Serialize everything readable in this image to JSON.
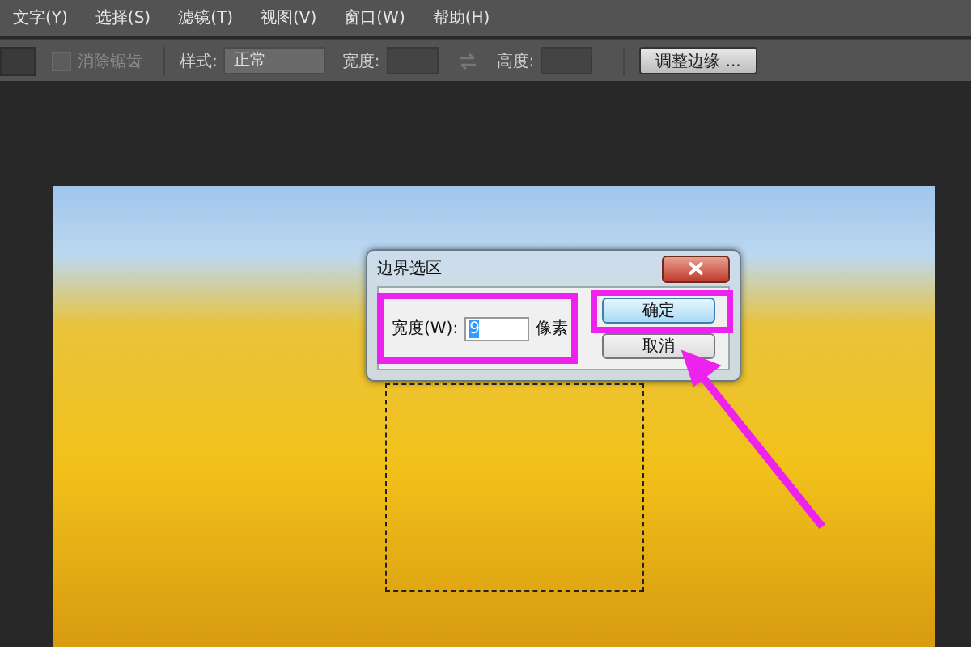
{
  "menu": [
    {
      "label": "文字(Y)"
    },
    {
      "label": "选择(S)"
    },
    {
      "label": "滤镜(T)"
    },
    {
      "label": "视图(V)"
    },
    {
      "label": "窗口(W)"
    },
    {
      "label": "帮助(H)"
    }
  ],
  "options_bar": {
    "anti_alias": {
      "label": "消除锯齿",
      "checked": false
    },
    "style_label": "样式:",
    "style_value": "正常",
    "width_label": "宽度:",
    "height_label": "高度:",
    "refine_button": "调整边缘 ..."
  },
  "dialog": {
    "title": "边界选区",
    "width_label": "宽度(W):",
    "width_value": "9",
    "unit": "像素",
    "buttons": [
      {
        "label": "确定",
        "selected": true
      },
      {
        "label": "取消",
        "selected": false
      }
    ]
  }
}
